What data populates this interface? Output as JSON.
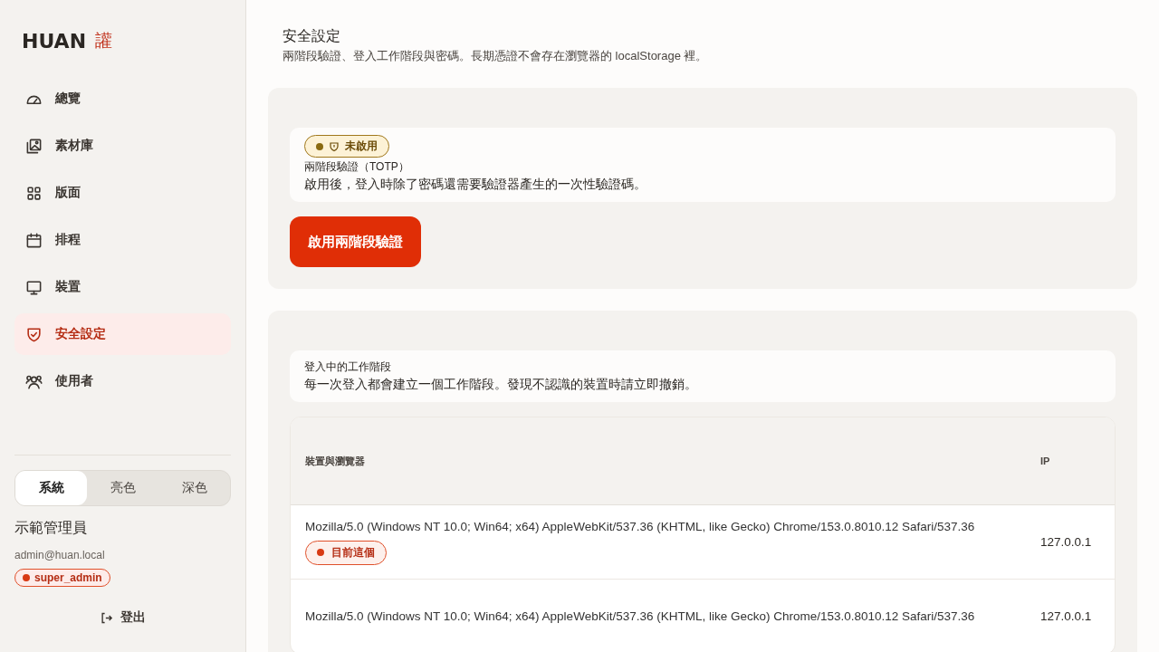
{
  "brand": {
    "name": "HUAN",
    "mark": "讙"
  },
  "nav": [
    {
      "label": "總覽",
      "kind": "gauge",
      "selected": false
    },
    {
      "label": "素材庫",
      "kind": "images",
      "selected": false
    },
    {
      "label": "版面",
      "kind": "grid",
      "selected": false
    },
    {
      "label": "排程",
      "kind": "calendar",
      "selected": false
    },
    {
      "label": "裝置",
      "kind": "monitor",
      "selected": false
    },
    {
      "label": "安全設定",
      "kind": "shield",
      "selected": true
    },
    {
      "label": "使用者",
      "kind": "users",
      "selected": false
    }
  ],
  "theme_tabs": [
    {
      "label": "系統",
      "selected": true
    },
    {
      "label": "亮色",
      "selected": false
    },
    {
      "label": "深色",
      "selected": false
    }
  ],
  "user": {
    "name": "示範管理員",
    "email": "admin@huan.local",
    "role": "super_admin"
  },
  "logout": "登出",
  "page": {
    "title": "安全設定",
    "subtitle": "兩階段驗證、登入工作階段與密碼。長期憑證不會存在瀏覽器的 localStorage 裡。"
  },
  "totp": {
    "status": "未啟用",
    "enabled": false,
    "title": "兩階段驗證（TOTP）",
    "description": "啟用後，登入時除了密碼還需要驗證器產生的一次性驗證碼。",
    "button": "啟用兩階段驗證"
  },
  "sessions": {
    "title": "登入中的工作階段",
    "description": "每一次登入都會建立一個工作階段。發現不認識的裝置時請立即撤銷。",
    "columns": [
      "裝置與瀏覽器",
      "IP"
    ],
    "rows": [
      {
        "agent": "Mozilla/5.0 (Windows NT 10.0; Win64; x64) AppleWebKit/537.36 (KHTML, like Gecko) Chrome/153.0.8010.12 Safari/537.36",
        "ip": "127.0.0.1",
        "current": true,
        "current_label": "目前這個"
      },
      {
        "agent": "Mozilla/5.0 (Windows NT 10.0; Win64; x64) AppleWebKit/537.36 (KHTML, like Gecko) Chrome/153.0.8010.12 Safari/537.36",
        "ip": "127.0.0.1",
        "current": false
      }
    ]
  }
}
